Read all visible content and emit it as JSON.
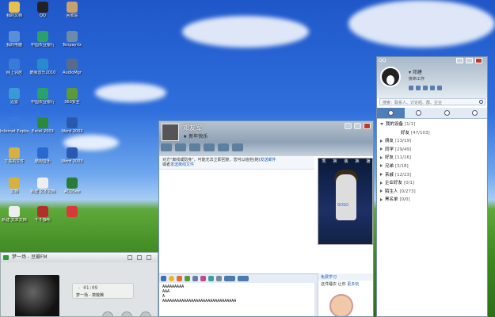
{
  "desktop": {
    "icons": [
      {
        "label": "我的文档",
        "color": "#e8c050"
      },
      {
        "label": "QQ",
        "color": "#222222"
      },
      {
        "label": "回收站",
        "color": "#c8a070"
      },
      {
        "label": "我的电脑",
        "color": "#5a8fd8"
      },
      {
        "label": "中国农业银行",
        "color": "#2aa06a"
      },
      {
        "label": "Tenpayrix",
        "color": "#6d8aa8"
      },
      {
        "label": "网上邻居",
        "color": "#3a7ad8"
      },
      {
        "label": "酷我音乐2010",
        "color": "#2a8ad0"
      },
      {
        "label": "AudioMgr",
        "color": "#5a6a8a"
      },
      {
        "label": "迅雷",
        "color": "#3a9ad8"
      },
      {
        "label": "中国农业银行",
        "color": "#2aa06a"
      },
      {
        "label": "360安全",
        "color": "#5a9a3a"
      },
      {
        "label": "Internet Explorer",
        "color": "#3a7ae0"
      },
      {
        "label": "Excel 2003",
        "color": "#2a8a3a"
      },
      {
        "label": "Word 2003",
        "color": "#2a5ab0"
      },
      {
        "label": "下载的文件",
        "color": "#d8b040"
      },
      {
        "label": "酷狗音乐",
        "color": "#2a6ad0"
      },
      {
        "label": "Word 2003",
        "color": "#2a5ab0"
      },
      {
        "label": "文档",
        "color": "#d8b040"
      },
      {
        "label": "新建 文本文档",
        "color": "#eeeeee"
      },
      {
        "label": "ACDSee",
        "color": "#2a7a3a"
      },
      {
        "label": "新建 文本文档",
        "color": "#eeeeee"
      },
      {
        "label": "千千静听",
        "color": "#b0302a"
      },
      {
        "label": "",
        "color": "#d83a3a"
      }
    ]
  },
  "chat": {
    "contact_name": "邓友军",
    "signature": "新年快乐",
    "notice_text": "对方\"离线或隐身\"，可能无法立即回复，您可以给他(她)",
    "notice_link1": "发送邮件",
    "notice_or": "或者",
    "notice_link2": "发送离线文件",
    "photo_labels": [
      "秀",
      "换",
      "装",
      "换",
      "播"
    ],
    "photo_caption": "SOSO",
    "input_lines": [
      "AAAAAAAAA",
      "AAA",
      "A",
      "AAAAAAAAAAAAAAAAAAAAAAAAAAAAAAA"
    ],
    "ad_title": "免费学习",
    "ad_line1": "这件睡衣",
    "ad_line2": "让你",
    "ad_link": "更多玩"
  },
  "qq": {
    "title": "QQ",
    "username": "邓建",
    "user_status": "拼命工作",
    "search_placeholder": "搜索：联系人、讨论组、群、企业",
    "groups": [
      {
        "name": "我的设备",
        "count": "[1/1]",
        "open": true,
        "sub": false
      },
      {
        "name": "好友",
        "count": "[47/103]",
        "open": false,
        "sub": true
      },
      {
        "name": "朋友",
        "count": "[13/19]",
        "open": false,
        "sub": false
      },
      {
        "name": "同学",
        "count": "[29/49]",
        "open": false,
        "sub": false
      },
      {
        "name": "好友",
        "count": "[11/16]",
        "open": false,
        "sub": false
      },
      {
        "name": "兄弟",
        "count": "[3/18]",
        "open": false,
        "sub": false
      },
      {
        "name": "亲戚",
        "count": "[12/23]",
        "open": false,
        "sub": false
      },
      {
        "name": "企业好友",
        "count": "[0/1]",
        "open": false,
        "sub": false
      },
      {
        "name": "陌生人",
        "count": "[0/273]",
        "open": false,
        "sub": false
      },
      {
        "name": "黑名单",
        "count": "[0/0]",
        "open": false,
        "sub": false
      }
    ]
  },
  "player": {
    "title": "梦一场 - 豆瓣FM",
    "time": "- 01:09",
    "song": "梦一场 - 萧敬腾"
  }
}
